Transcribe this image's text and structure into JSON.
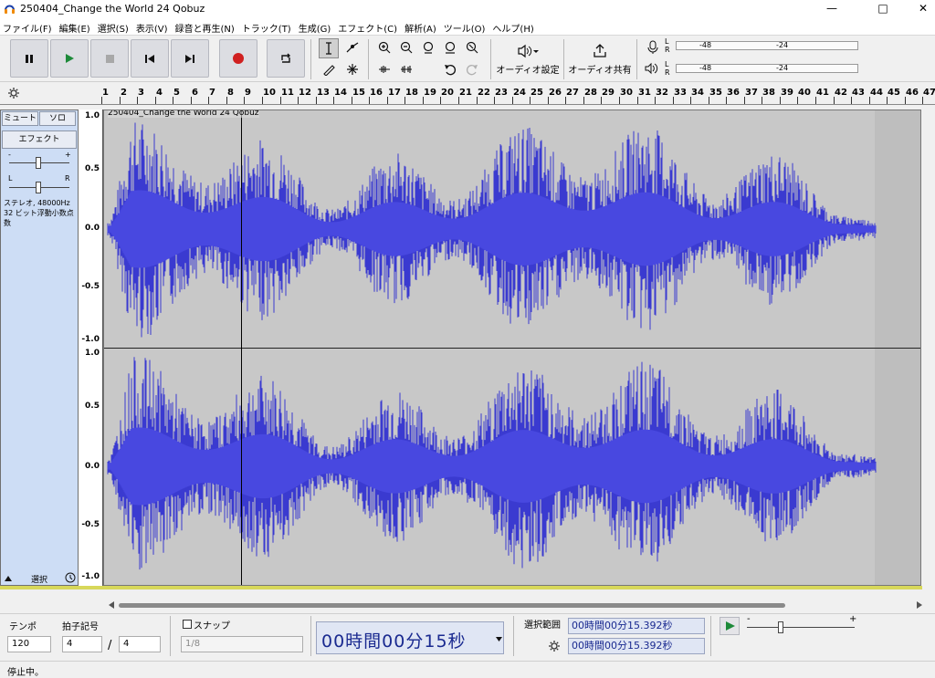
{
  "window": {
    "title": "250404_Change the World 24 Qobuz"
  },
  "menu": [
    "ファイル(F)",
    "編集(E)",
    "選択(S)",
    "表示(V)",
    "録音と再生(N)",
    "トラック(T)",
    "生成(G)",
    "エフェクト(C)",
    "解析(A)",
    "ツール(O)",
    "ヘルプ(H)"
  ],
  "toolbar": {
    "audio_setup": "オーディオ設定",
    "share_audio": "オーディオ共有",
    "meter_ticks": [
      "-48",
      "-24"
    ],
    "channels": [
      "L",
      "R"
    ]
  },
  "ruler": {
    "ticks": [
      "1",
      "2",
      "3",
      "4",
      "5",
      "6",
      "7",
      "8",
      "9",
      "10",
      "11",
      "12",
      "13",
      "14",
      "15",
      "16",
      "17",
      "18",
      "19",
      "20",
      "21",
      "22",
      "23",
      "24",
      "25",
      "26",
      "27",
      "28",
      "29",
      "30",
      "31",
      "32",
      "33",
      "34",
      "35",
      "36",
      "37",
      "38",
      "39",
      "40",
      "41",
      "42",
      "43",
      "44",
      "45",
      "46",
      "47"
    ]
  },
  "track": {
    "name": "250404_Change the World 24 Qobuz",
    "mute": "ミュート",
    "solo": "ソロ",
    "effects": "エフェクト",
    "gain_minus": "-",
    "gain_plus": "+",
    "pan_left": "L",
    "pan_right": "R",
    "format_line1": "ステレオ, 48000Hz",
    "format_line2": "32 ビット浮動小数点数",
    "select": "選択",
    "scale": [
      "1.0",
      "0.5",
      "0.0",
      "-0.5",
      "-1.0"
    ],
    "waveform_color": "#3a3ad0"
  },
  "bottom": {
    "tempo_label": "テンポ",
    "tempo_value": "120",
    "timesig_label": "拍子記号",
    "timesig_num": "4",
    "timesig_slash": "/",
    "timesig_den": "4",
    "snap_label": "スナップ",
    "snap_value": "1/8",
    "time_display": "00時間00分15秒",
    "selection_label": "選択範囲",
    "sel_start": "00時間00分15.392秒",
    "sel_end": "00時間00分15.392秒",
    "speed_minus": "-",
    "speed_plus": "+"
  },
  "status": {
    "text": "停止中。"
  }
}
